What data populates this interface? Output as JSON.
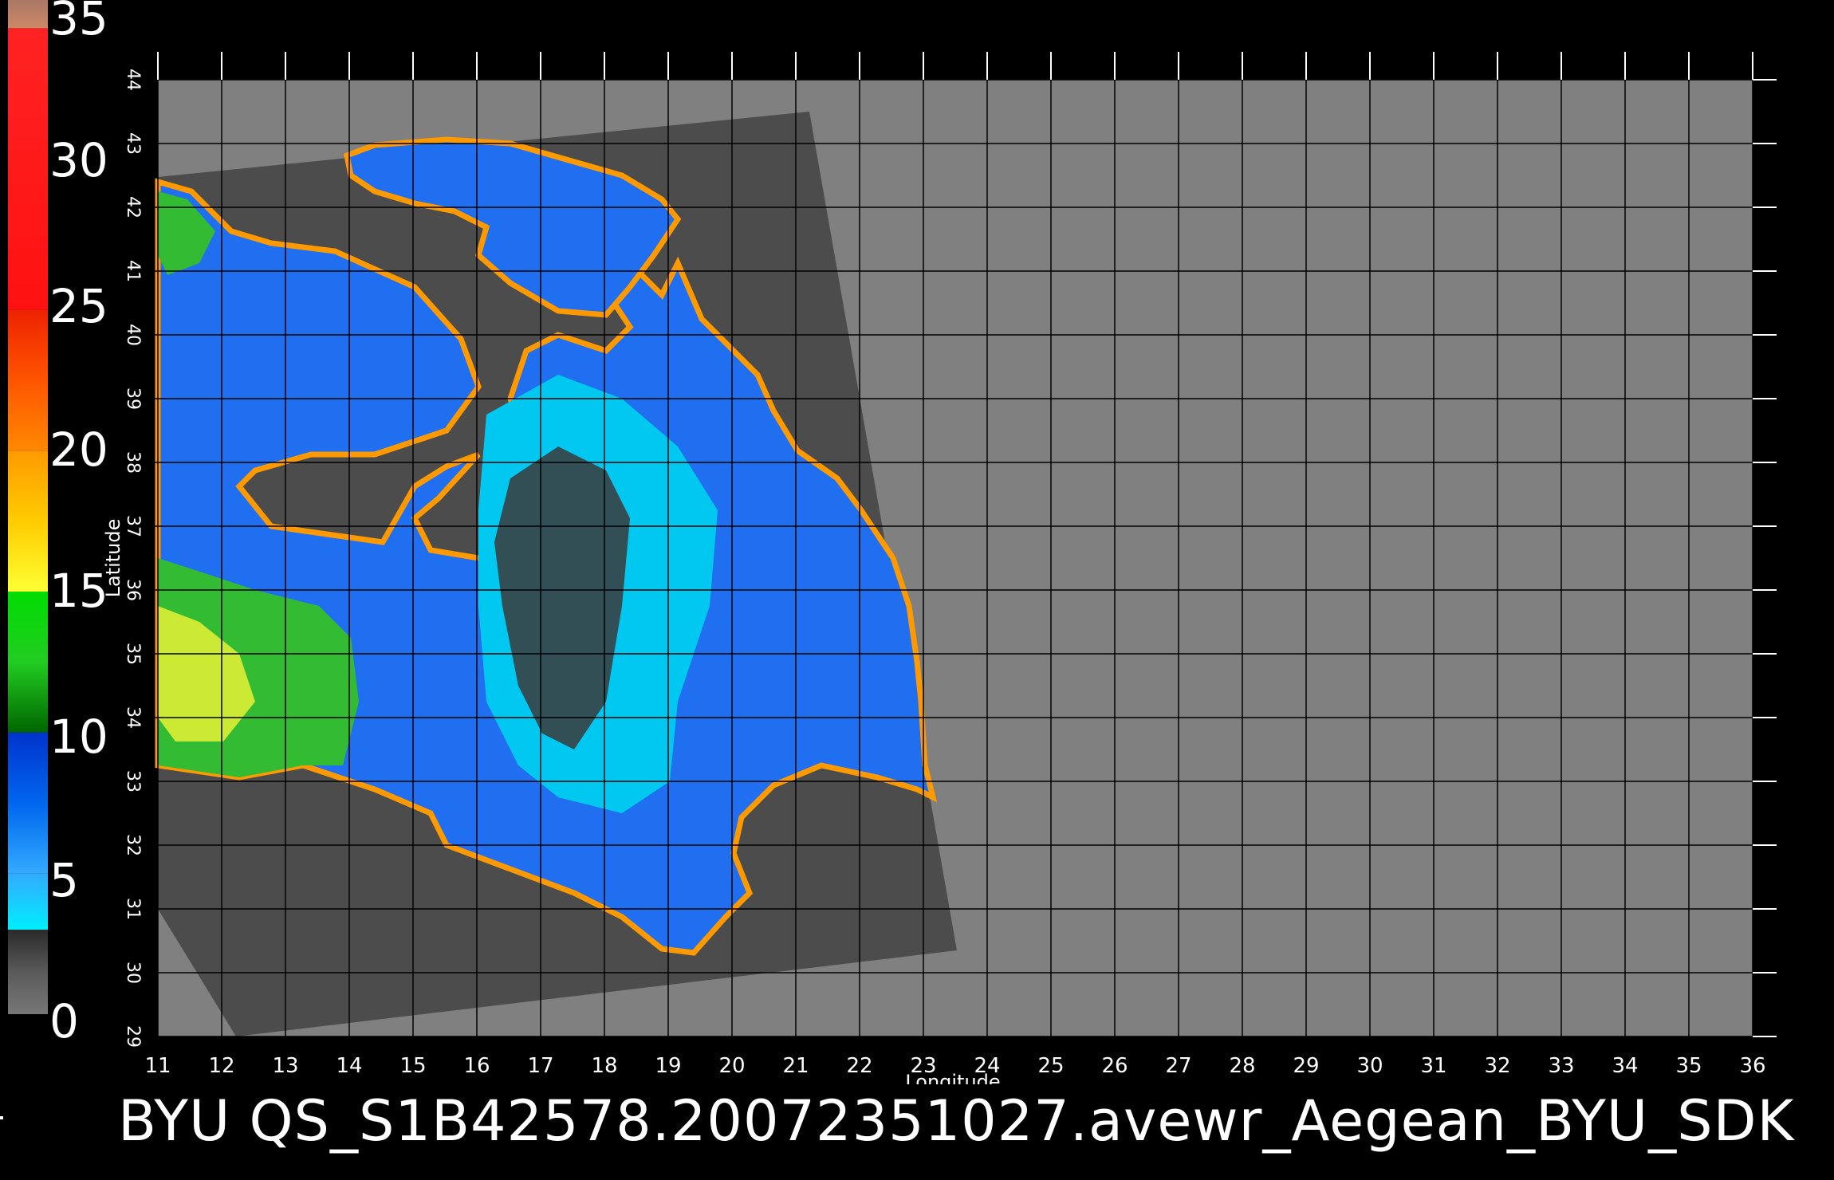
{
  "colorbar": {
    "labels": [
      "35",
      "30",
      "25",
      "20",
      "15",
      "10",
      "5",
      "0"
    ],
    "stops": [
      {
        "from": 0,
        "to": 3,
        "colors": [
          "#777777",
          "#5a5a5a",
          "#2a2a2a"
        ]
      },
      {
        "from": 3,
        "to": 5,
        "colors": [
          "#00eeff",
          "#33aaff"
        ]
      },
      {
        "from": 5,
        "to": 10,
        "colors": [
          "#33aaff",
          "#0066ee",
          "#0033cc"
        ]
      },
      {
        "from": 10,
        "to": 15,
        "colors": [
          "#006600",
          "#22cc22",
          "#00dd00"
        ]
      },
      {
        "from": 15,
        "to": 20,
        "colors": [
          "#ffff33",
          "#ffcc00",
          "#ff9900"
        ]
      },
      {
        "from": 20,
        "to": 25,
        "colors": [
          "#ff8800",
          "#ff5500",
          "#ee2200"
        ]
      },
      {
        "from": 25,
        "to": 35,
        "colors": [
          "#ff1111",
          "#ff2222"
        ]
      },
      {
        "from": 35,
        "to": 36,
        "colors": [
          "#cc8866",
          "#aa7766"
        ]
      }
    ]
  },
  "axes": {
    "x_label": "Longitude",
    "y_label": "Latitude",
    "lon_ticks": [
      "11",
      "12",
      "13",
      "14",
      "15",
      "16",
      "17",
      "18",
      "19",
      "20",
      "21",
      "22",
      "23",
      "24",
      "25",
      "26",
      "27",
      "28",
      "29",
      "30",
      "31",
      "32",
      "33",
      "34",
      "35",
      "36"
    ],
    "lat_ticks": [
      "29",
      "30",
      "31",
      "32",
      "33",
      "34",
      "35",
      "36",
      "37",
      "38",
      "39",
      "40",
      "41",
      "42",
      "43",
      "44"
    ]
  },
  "colors": {
    "background": "#000000",
    "no_data": "#808080",
    "land_swath": "#4c4c4c",
    "grid": "#000000"
  },
  "caption": "BYU  QS_S1B42578.20072351027.avewr_Aegean_BYU_SDK"
}
